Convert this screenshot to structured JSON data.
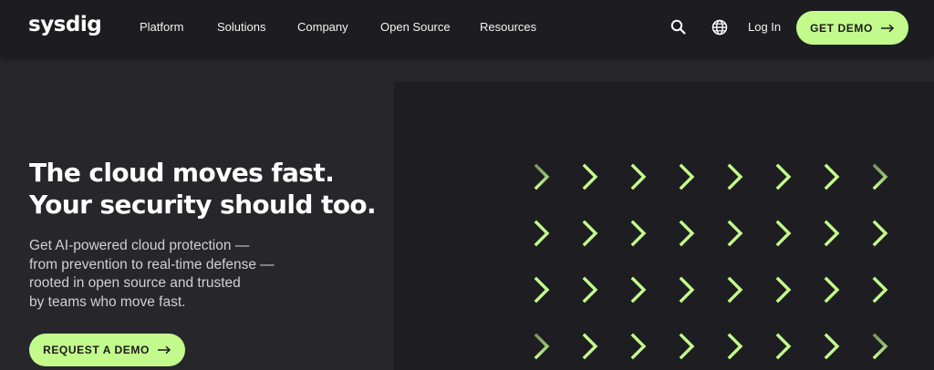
{
  "colors": {
    "accent": "#c3fa8c",
    "nav_background": "#1d1d21",
    "page_background": "#26262b",
    "panel_background": "#1e1e22"
  },
  "nav": {
    "logo": "sysdig",
    "items": [
      "Platform",
      "Solutions",
      "Company",
      "Open Source",
      "Resources"
    ],
    "icons": [
      "search-icon",
      "globe-icon"
    ],
    "login": "Log In",
    "cta": "GET DEMO"
  },
  "hero": {
    "headline_line1": "The cloud moves fast.",
    "headline_line2": "Your security should too.",
    "subtitle_lines": [
      "Get AI-powered cloud protection —",
      "from prevention to real-time defense —",
      "rooted in open source and trusted",
      "by teams who move fast."
    ],
    "cta": "REQUEST A DEMO"
  },
  "graphic": {
    "icon": "chevron-right-icon",
    "rows": 4,
    "columns": 8
  }
}
